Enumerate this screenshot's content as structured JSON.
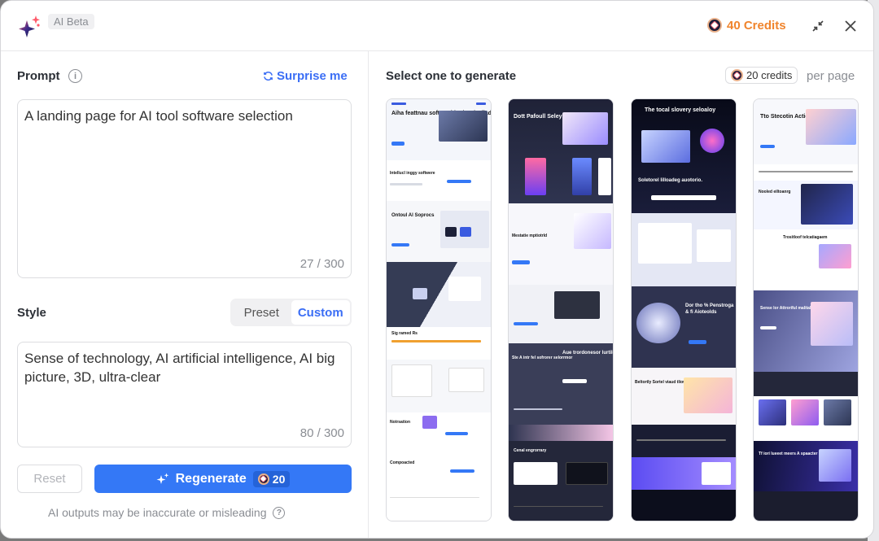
{
  "header": {
    "beta_badge": "AI Beta",
    "credits_label": "40 Credits",
    "brand_color": "#3b6ef5",
    "credits_color": "#f0842c",
    "icons": [
      "sparkles-logo-icon",
      "credit-coin-icon",
      "collapse-icon",
      "close-icon"
    ]
  },
  "prompt": {
    "label": "Prompt",
    "surprise_label": "Surprise me",
    "value": "A landing page for  AI tool software selection",
    "counter": "27 / 300"
  },
  "style": {
    "label": "Style",
    "tabs": [
      {
        "label": "Preset",
        "active": false
      },
      {
        "label": "Custom",
        "active": true
      }
    ],
    "value": "Sense of technology, AI artificial intelligence, AI big picture, 3D, ultra-clear",
    "counter": "80 / 300"
  },
  "actions": {
    "reset_label": "Reset",
    "regenerate_label": "Regenerate",
    "regenerate_cost": "20"
  },
  "disclaimer": "AI outputs may be inaccurate or misleading",
  "results": {
    "title": "Select one to generate",
    "cost_label": "20 credits",
    "per_page": "per page",
    "previews": [
      {
        "theme": "light",
        "headings": [
          "Aiha feattnau softyorride ri, selealiade",
          "Intellucl inggy softwere",
          "Ontoul Al Soprocs",
          "Sig ramed Rs",
          "Notrsation",
          "Compoacted"
        ]
      },
      {
        "theme": "dark",
        "headings": [
          "Dott Pafoull Seleyriaied.",
          "Mestatie mptiotrld",
          "Ste A intr fel sofrorer selorrmor",
          "Aue trordonesor lurtilol esn",
          "Cenal engrorrary"
        ]
      },
      {
        "theme": "dark",
        "headings": [
          "The tocal slovery seloaloy",
          "Soletorel lilloadeg auotorio.",
          "Dor tho % Penstroga & fi Aioteolds",
          "Beltortly Sortel viaud tliowrd"
        ]
      },
      {
        "theme": "light",
        "headings": [
          "Tto Stecotin Actiction.",
          "Nooled eiltoanrg",
          "Trositloof telcatiagaem",
          "Sense lor Attroriful malitalo",
          "Tf iori lueeet meers A spaacter"
        ]
      }
    ]
  }
}
